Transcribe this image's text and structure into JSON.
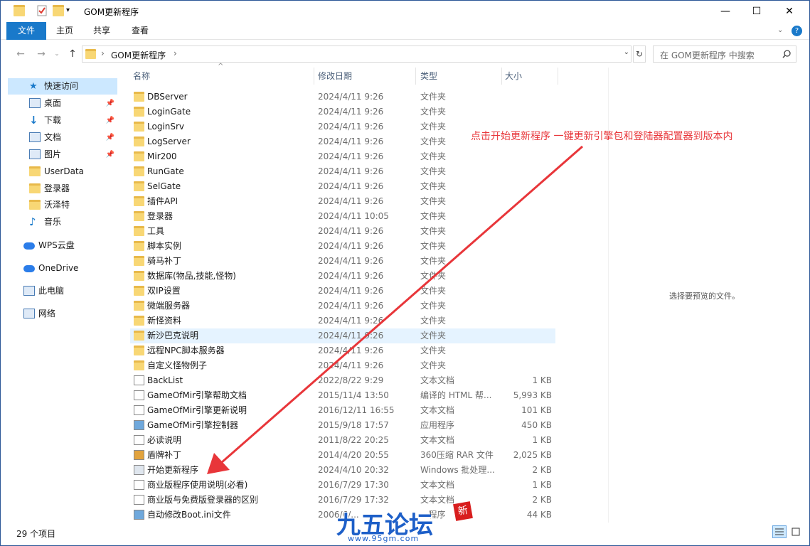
{
  "window": {
    "title": "GOM更新程序",
    "minimize": "—",
    "maximize": "☐",
    "close": "✕"
  },
  "ribbon": {
    "tabs": [
      "文件",
      "主页",
      "共享",
      "查看"
    ]
  },
  "nav": {
    "back": "←",
    "forward": "→",
    "up": "↑",
    "refresh": "↻"
  },
  "address": {
    "path": "GOM更新程序"
  },
  "search": {
    "placeholder": "在 GOM更新程序 中搜索"
  },
  "sidebar": {
    "items": [
      {
        "label": "快速访问",
        "pinned": false
      },
      {
        "label": "桌面",
        "pinned": true
      },
      {
        "label": "下载",
        "pinned": true
      },
      {
        "label": "文档",
        "pinned": true
      },
      {
        "label": "图片",
        "pinned": true
      },
      {
        "label": "UserData",
        "pinned": false
      },
      {
        "label": "登录器",
        "pinned": false
      },
      {
        "label": "沃泽特",
        "pinned": false
      },
      {
        "label": "音乐",
        "pinned": false
      },
      {
        "label": "WPS云盘",
        "pinned": false
      },
      {
        "label": "OneDrive",
        "pinned": false
      },
      {
        "label": "此电脑",
        "pinned": false
      },
      {
        "label": "网络",
        "pinned": false
      }
    ]
  },
  "columns": {
    "name": "名称",
    "date": "修改日期",
    "type": "类型",
    "size": "大小"
  },
  "files": [
    {
      "name": "DBServer",
      "date": "2024/4/11 9:26",
      "type": "文件夹",
      "size": "",
      "kind": "folder"
    },
    {
      "name": "LoginGate",
      "date": "2024/4/11 9:26",
      "type": "文件夹",
      "size": "",
      "kind": "folder"
    },
    {
      "name": "LoginSrv",
      "date": "2024/4/11 9:26",
      "type": "文件夹",
      "size": "",
      "kind": "folder"
    },
    {
      "name": "LogServer",
      "date": "2024/4/11 9:26",
      "type": "文件夹",
      "size": "",
      "kind": "folder"
    },
    {
      "name": "Mir200",
      "date": "2024/4/11 9:26",
      "type": "文件夹",
      "size": "",
      "kind": "folder"
    },
    {
      "name": "RunGate",
      "date": "2024/4/11 9:26",
      "type": "文件夹",
      "size": "",
      "kind": "folder"
    },
    {
      "name": "SelGate",
      "date": "2024/4/11 9:26",
      "type": "文件夹",
      "size": "",
      "kind": "folder"
    },
    {
      "name": "插件API",
      "date": "2024/4/11 9:26",
      "type": "文件夹",
      "size": "",
      "kind": "folder"
    },
    {
      "name": "登录器",
      "date": "2024/4/11 10:05",
      "type": "文件夹",
      "size": "",
      "kind": "folder"
    },
    {
      "name": "工具",
      "date": "2024/4/11 9:26",
      "type": "文件夹",
      "size": "",
      "kind": "folder"
    },
    {
      "name": "脚本实例",
      "date": "2024/4/11 9:26",
      "type": "文件夹",
      "size": "",
      "kind": "folder"
    },
    {
      "name": "骑马补丁",
      "date": "2024/4/11 9:26",
      "type": "文件夹",
      "size": "",
      "kind": "folder"
    },
    {
      "name": "数据库(物品,技能,怪物)",
      "date": "2024/4/11 9:26",
      "type": "文件夹",
      "size": "",
      "kind": "folder"
    },
    {
      "name": "双IP设置",
      "date": "2024/4/11 9:26",
      "type": "文件夹",
      "size": "",
      "kind": "folder"
    },
    {
      "name": "微端服务器",
      "date": "2024/4/11 9:26",
      "type": "文件夹",
      "size": "",
      "kind": "folder"
    },
    {
      "name": "新怪资料",
      "date": "2024/4/11 9:26",
      "type": "文件夹",
      "size": "",
      "kind": "folder"
    },
    {
      "name": "新沙巴克说明",
      "date": "2024/4/11 9:26",
      "type": "文件夹",
      "size": "",
      "kind": "folder"
    },
    {
      "name": "远程NPC脚本服务器",
      "date": "2024/4/11 9:26",
      "type": "文件夹",
      "size": "",
      "kind": "folder"
    },
    {
      "name": "自定义怪物例子",
      "date": "2024/4/11 9:26",
      "type": "文件夹",
      "size": "",
      "kind": "folder"
    },
    {
      "name": "BackList",
      "date": "2022/8/22 9:29",
      "type": "文本文档",
      "size": "1 KB",
      "kind": "doc"
    },
    {
      "name": "GameOfMir引擎帮助文档",
      "date": "2015/11/4 13:50",
      "type": "编译的 HTML 帮...",
      "size": "5,993 KB",
      "kind": "doc"
    },
    {
      "name": "GameOfMir引擎更新说明",
      "date": "2016/12/11 16:55",
      "type": "文本文档",
      "size": "101 KB",
      "kind": "doc"
    },
    {
      "name": "GameOfMir引擎控制器",
      "date": "2015/9/18 17:57",
      "type": "应用程序",
      "size": "450 KB",
      "kind": "app"
    },
    {
      "name": "必读说明",
      "date": "2011/8/22 20:25",
      "type": "文本文档",
      "size": "1 KB",
      "kind": "doc"
    },
    {
      "name": "盾牌补丁",
      "date": "2014/4/20 20:55",
      "type": "360压缩 RAR 文件",
      "size": "2,025 KB",
      "kind": "rar"
    },
    {
      "name": "开始更新程序",
      "date": "2024/4/10 20:32",
      "type": "Windows 批处理...",
      "size": "2 KB",
      "kind": "bat"
    },
    {
      "name": "商业版程序使用说明(必看)",
      "date": "2016/7/29 17:30",
      "type": "文本文档",
      "size": "1 KB",
      "kind": "doc"
    },
    {
      "name": "商业版与免费版登录器的区别",
      "date": "2016/7/29 17:32",
      "type": "文本文档",
      "size": "2 KB",
      "kind": "doc"
    },
    {
      "name": "自动修改Boot.ini文件",
      "date": "2006/6/...",
      "type": "...程序",
      "size": "44 KB",
      "kind": "app"
    }
  ],
  "preview_text": "选择要预览的文件。",
  "annotation": "点击开始更新程序 一键更新引擎包和登陆器配置器到版本内",
  "status": {
    "count": "29 个项目"
  },
  "watermark": {
    "title": "九五论坛",
    "url": "www.95gm.com",
    "badge": "新"
  },
  "colors": {
    "accent": "#1979ca",
    "annotation": "#e8363a",
    "folder": "#f8d775",
    "hover": "#e5f3ff"
  }
}
